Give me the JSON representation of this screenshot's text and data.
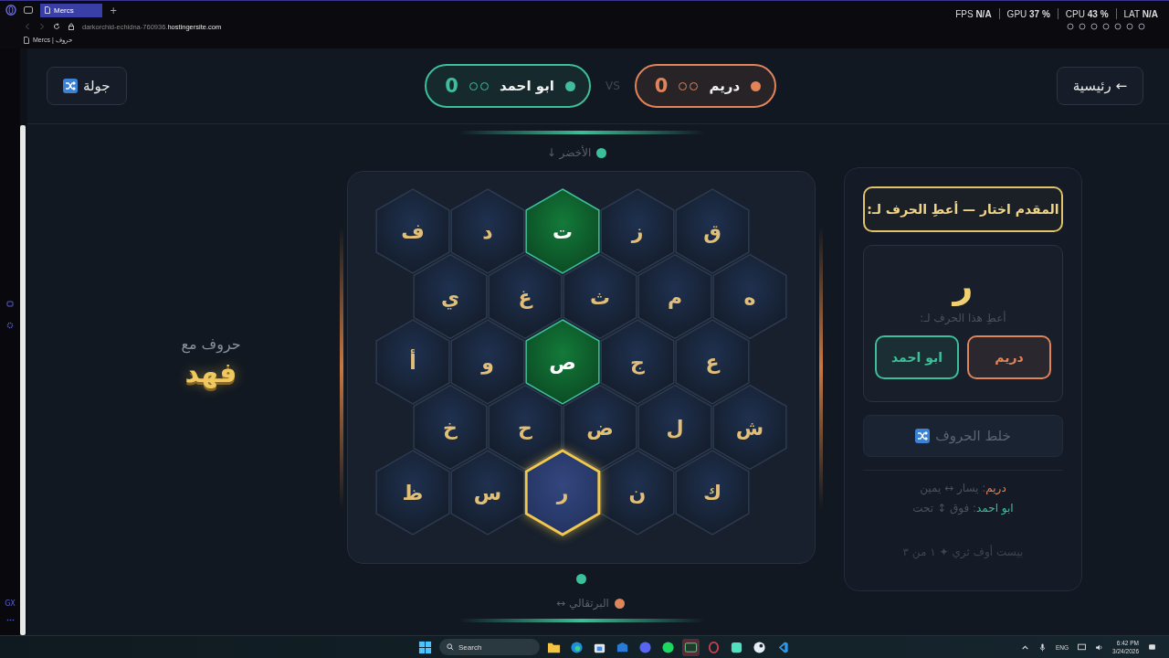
{
  "browser": {
    "tab": "Mercs",
    "new_tab": "+",
    "url": {
      "sub": "darkorchid-echidna-760936.",
      "domain": "hostingersite.com"
    },
    "bookmark": "Mercs | حروف",
    "stats": [
      "LAT **N/A**",
      "CPU **43 %**",
      "GPU **37 %**",
      "FPS **N/A**"
    ],
    "side_label": "GX"
  },
  "header": {
    "home_button": "← رئيسية",
    "round_button": "جولة",
    "vs": "VS"
  },
  "teams": [
    {
      "name": "دريم",
      "color": "#e0845a",
      "score": "0",
      "rounds": [
        {
          "won": false
        },
        {
          "won": false
        }
      ]
    },
    {
      "name": "ابو احمد",
      "color": "#3dbf9a",
      "score": "0",
      "rounds": [
        {
          "won": false
        },
        {
          "won": false
        }
      ]
    }
  ],
  "left": {
    "caption": "حروف مع",
    "name": "فهد"
  },
  "board": {
    "top": {
      "label": "الأخضر ↓",
      "color": "#3dbf9a"
    },
    "bottom": {
      "label": "البرتقالي ↔",
      "color": "#e0845a"
    },
    "rows": [
      [
        {
          "letter": "ق",
          "kind": "empty",
          "selected": false
        },
        {
          "letter": "ز",
          "kind": "empty",
          "selected": false
        },
        {
          "letter": "ت",
          "kind": "green",
          "selected": false
        },
        {
          "letter": "د",
          "kind": "empty",
          "selected": false
        },
        {
          "letter": "ف",
          "kind": "empty",
          "selected": false
        }
      ],
      [
        {
          "letter": "ه",
          "kind": "empty",
          "selected": false
        },
        {
          "letter": "م",
          "kind": "empty",
          "selected": false
        },
        {
          "letter": "ث",
          "kind": "empty",
          "selected": false
        },
        {
          "letter": "غ",
          "kind": "empty",
          "selected": false
        },
        {
          "letter": "ي",
          "kind": "empty",
          "selected": false
        }
      ],
      [
        {
          "letter": "ع",
          "kind": "empty",
          "selected": false
        },
        {
          "letter": "ج",
          "kind": "empty",
          "selected": false
        },
        {
          "letter": "ص",
          "kind": "green",
          "selected": false
        },
        {
          "letter": "و",
          "kind": "empty",
          "selected": false
        },
        {
          "letter": "أ",
          "kind": "empty",
          "selected": false
        }
      ],
      [
        {
          "letter": "ش",
          "kind": "empty",
          "selected": false
        },
        {
          "letter": "ل",
          "kind": "empty",
          "selected": false
        },
        {
          "letter": "ض",
          "kind": "empty",
          "selected": false
        },
        {
          "letter": "ح",
          "kind": "empty",
          "selected": false
        },
        {
          "letter": "خ",
          "kind": "empty",
          "selected": false
        }
      ],
      [
        {
          "letter": "ك",
          "kind": "empty",
          "selected": false
        },
        {
          "letter": "ن",
          "kind": "empty",
          "selected": false
        },
        {
          "letter": "ر",
          "kind": "empty",
          "selected": true
        },
        {
          "letter": "س",
          "kind": "empty",
          "selected": false
        },
        {
          "letter": "ظ",
          "kind": "empty",
          "selected": false
        }
      ]
    ]
  },
  "panel": {
    "prompt": "المقدم اختار — أعطِ الحرف لـ:",
    "letter": "ر",
    "hint": "أعطِ هذا الحرف لـ:",
    "give_buttons": [
      {
        "label": "دريم",
        "color": "#e0845a"
      },
      {
        "label": "ابو احمد",
        "color": "#3dbf9a"
      }
    ],
    "shuffle": "خلط الحروف",
    "legend": [
      {
        "color": "#e0845a",
        "name": "دريم",
        "text": ": يسار ↔ يمين"
      },
      {
        "color": "#3dbf9a",
        "name": "ابو احمد",
        "text": ": فوق ↕ تحت"
      }
    ],
    "footer": "بيست أوف ثري ✦ ١ من ٣"
  },
  "taskbar": {
    "search": "Search",
    "lang": "ENG",
    "time": "6:42 PM",
    "date": "3/24/2026"
  }
}
